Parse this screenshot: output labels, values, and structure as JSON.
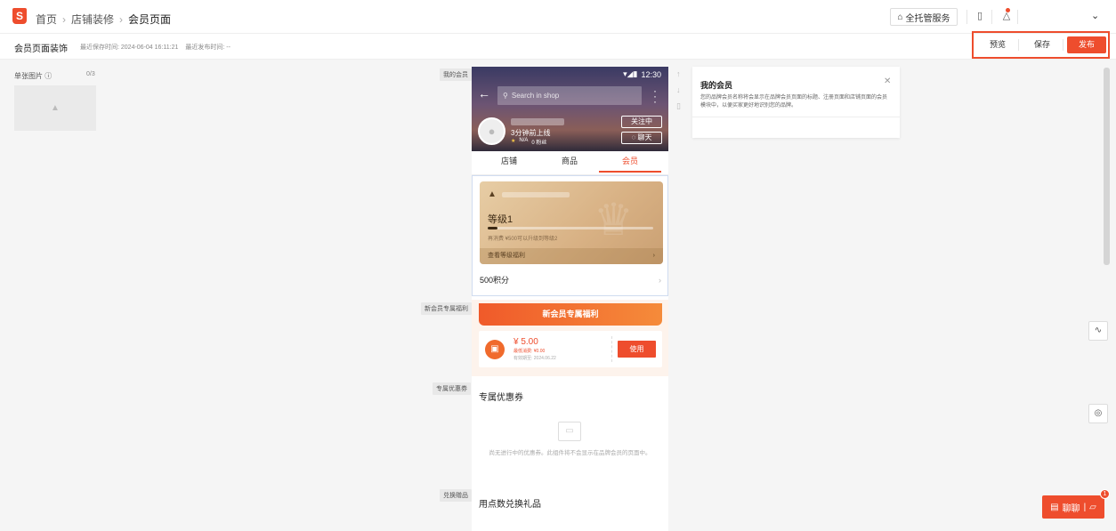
{
  "header": {
    "logo": "S",
    "breadcrumb": [
      "首页",
      "店铺装修",
      "会员页面"
    ],
    "separator": "›",
    "service_label": "全托管服务",
    "caret": "⌄"
  },
  "subbar": {
    "title": "会员页面装饰",
    "last_saved": "最近保存时间: 2024-06-04 16:11:21",
    "last_published": "最近发布时间: --",
    "actions": {
      "preview": "预览",
      "save": "保存",
      "publish": "发布"
    }
  },
  "left_panel": {
    "label": "单张图片",
    "count": "0/3"
  },
  "section_tags": {
    "my_member": "我的会员",
    "new_member": "新会员专属福利",
    "coupons": "专属优惠券",
    "redeem": "兑换赠品"
  },
  "phone": {
    "status_time": "12:30",
    "search_placeholder": "Search in shop",
    "online": "3分钟前上线",
    "rating": "N/A",
    "followers": "0 粉丝",
    "follow_label": "关注中",
    "chat_label": "聊天",
    "tabs": [
      "店铺",
      "商品",
      "会员"
    ],
    "card": {
      "level": "等级1",
      "progress_fraction": 0.06,
      "progress_note": "再消费 ¥500可以升级到等级2",
      "footer": "查看等级福利"
    },
    "points": "500积分",
    "new_member_banner": "新会员专属福利",
    "voucher": {
      "amount": "¥ 5.00",
      "min_spend": "最低消费: ¥0.00",
      "expiry": "有效期至: 2024.06.22",
      "use_label": "使用"
    },
    "coupon_heading": "专属优惠券",
    "coupon_empty": "尚无进行中的优惠券。此组件将不会显示在品牌会员的页面中。",
    "gift_heading": "用点数兑换礼品"
  },
  "info_panel": {
    "title": "我的会员",
    "desc": "您的品牌会员名称将会显示在品牌会员页面的标题、注册页面和店铺页面的会员模块中，以便买家更好地识别您的品牌。"
  },
  "chat_float": {
    "label": "聊聊",
    "badge": "1"
  },
  "colors": {
    "brand": "#ee4d2d",
    "gold_card": "#d8b184",
    "highlight_box": "#ee4d2d"
  }
}
